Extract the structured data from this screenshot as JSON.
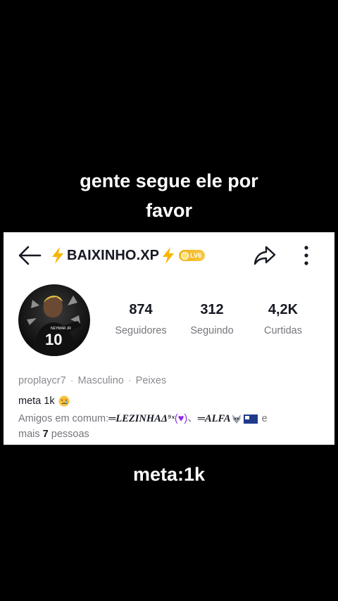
{
  "overlay": {
    "caption_line1": "gente segue ele por",
    "caption_line2": "favor",
    "caption_bottom": "meta:1k"
  },
  "profile": {
    "username_display": "BAIXINHO.XP",
    "level_badge": "LV6",
    "handle": "proplaycr7",
    "gender": "Masculino",
    "sign": "Peixes",
    "bio": "meta 1k",
    "stats": {
      "followers_value": "874",
      "followers_label": "Seguidores",
      "following_value": "312",
      "following_label": "Seguindo",
      "likes_value": "4,2K",
      "likes_label": "Curtidas"
    },
    "mutual": {
      "prefix": "Amigos em comum:",
      "friend1": "═LEZINHAΔ⁹ˣ",
      "friend2": "═ALFA",
      "and_word": "e",
      "more_prefix": "mais",
      "more_count": "7",
      "more_suffix": "pessoas"
    }
  },
  "icons": {
    "back": "back-arrow-icon",
    "bolt": "lightning-bolt-icon",
    "share": "share-arrow-icon",
    "more": "more-vertical-icon"
  },
  "colors": {
    "bolt": "#f7b500",
    "badge": "#f2b21a",
    "text_primary": "#161823",
    "text_secondary": "#75767c"
  }
}
